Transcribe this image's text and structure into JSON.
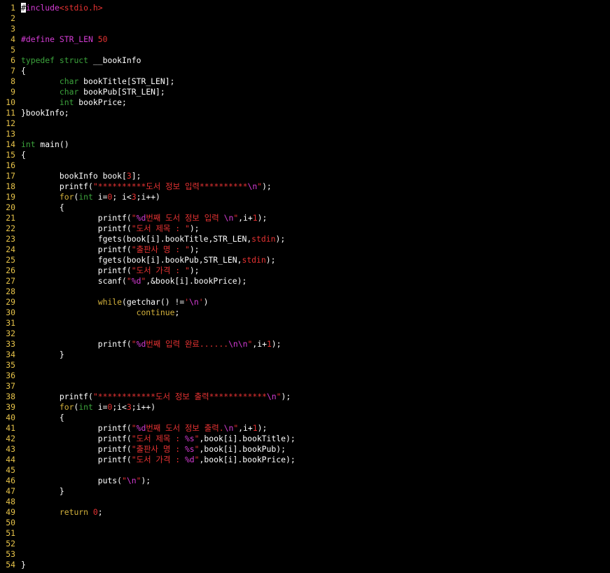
{
  "editor": {
    "colors": {
      "background": "#000000",
      "line_number": "#e8c44a",
      "preprocessor": "#d53cd5",
      "keyword": "#d4b23c",
      "type": "#3ca43c",
      "string": "#e83333",
      "number": "#e83333",
      "escape": "#d53cd5",
      "default": "#ffffff"
    },
    "cursor": {
      "line": 1,
      "column": 1
    },
    "lines": [
      {
        "n": "1",
        "tokens": [
          {
            "t": "#",
            "c": "cursor"
          },
          {
            "t": "include",
            "c": "pre"
          },
          {
            "t": "<stdio.h>",
            "c": "str"
          }
        ]
      },
      {
        "n": "2",
        "tokens": []
      },
      {
        "n": "3",
        "tokens": []
      },
      {
        "n": "4",
        "tokens": [
          {
            "t": "#define STR_LEN ",
            "c": "pre"
          },
          {
            "t": "50",
            "c": "num"
          }
        ]
      },
      {
        "n": "5",
        "tokens": []
      },
      {
        "n": "6",
        "tokens": [
          {
            "t": "typedef",
            "c": "type"
          },
          {
            "t": " ",
            "c": "id"
          },
          {
            "t": "struct",
            "c": "type"
          },
          {
            "t": " __bookInfo",
            "c": "id"
          }
        ]
      },
      {
        "n": "7",
        "tokens": [
          {
            "t": "{",
            "c": "id"
          }
        ]
      },
      {
        "n": "8",
        "tokens": [
          {
            "t": "        ",
            "c": "id"
          },
          {
            "t": "char",
            "c": "type"
          },
          {
            "t": " bookTitle[STR_LEN];",
            "c": "id"
          }
        ]
      },
      {
        "n": "9",
        "tokens": [
          {
            "t": "        ",
            "c": "id"
          },
          {
            "t": "char",
            "c": "type"
          },
          {
            "t": " bookPub[STR_LEN];",
            "c": "id"
          }
        ]
      },
      {
        "n": "10",
        "tokens": [
          {
            "t": "        ",
            "c": "id"
          },
          {
            "t": "int",
            "c": "type"
          },
          {
            "t": " bookPrice;",
            "c": "id"
          }
        ]
      },
      {
        "n": "11",
        "tokens": [
          {
            "t": "}bookInfo;",
            "c": "id"
          }
        ]
      },
      {
        "n": "12",
        "tokens": []
      },
      {
        "n": "13",
        "tokens": []
      },
      {
        "n": "14",
        "tokens": [
          {
            "t": "int",
            "c": "type"
          },
          {
            "t": " main()",
            "c": "id"
          }
        ]
      },
      {
        "n": "15",
        "tokens": [
          {
            "t": "{",
            "c": "id"
          }
        ]
      },
      {
        "n": "16",
        "tokens": []
      },
      {
        "n": "17",
        "tokens": [
          {
            "t": "        bookInfo book[",
            "c": "id"
          },
          {
            "t": "3",
            "c": "num"
          },
          {
            "t": "];",
            "c": "id"
          }
        ]
      },
      {
        "n": "18",
        "tokens": [
          {
            "t": "        printf(",
            "c": "id"
          },
          {
            "t": "\"**********도서 정보 입력**********",
            "c": "str"
          },
          {
            "t": "\\n",
            "c": "esc"
          },
          {
            "t": "\"",
            "c": "str"
          },
          {
            "t": ");",
            "c": "id"
          }
        ]
      },
      {
        "n": "19",
        "tokens": [
          {
            "t": "        ",
            "c": "id"
          },
          {
            "t": "for",
            "c": "kw"
          },
          {
            "t": "(",
            "c": "id"
          },
          {
            "t": "int",
            "c": "type"
          },
          {
            "t": " i=",
            "c": "id"
          },
          {
            "t": "0",
            "c": "num"
          },
          {
            "t": "; i<",
            "c": "id"
          },
          {
            "t": "3",
            "c": "num"
          },
          {
            "t": ";i++)",
            "c": "id"
          }
        ]
      },
      {
        "n": "20",
        "tokens": [
          {
            "t": "        {",
            "c": "id"
          }
        ]
      },
      {
        "n": "21",
        "tokens": [
          {
            "t": "                printf(",
            "c": "id"
          },
          {
            "t": "\"",
            "c": "str"
          },
          {
            "t": "%d",
            "c": "esc"
          },
          {
            "t": "번째 도서 정보 입력 ",
            "c": "str"
          },
          {
            "t": "\\n",
            "c": "esc"
          },
          {
            "t": "\"",
            "c": "str"
          },
          {
            "t": ",i+",
            "c": "id"
          },
          {
            "t": "1",
            "c": "num"
          },
          {
            "t": ");",
            "c": "id"
          }
        ]
      },
      {
        "n": "22",
        "tokens": [
          {
            "t": "                printf(",
            "c": "id"
          },
          {
            "t": "\"도서 제목 : \"",
            "c": "str"
          },
          {
            "t": ");",
            "c": "id"
          }
        ]
      },
      {
        "n": "23",
        "tokens": [
          {
            "t": "                fgets(book[i].bookTitle,STR_LEN,",
            "c": "id"
          },
          {
            "t": "stdin",
            "c": "str"
          },
          {
            "t": ");",
            "c": "id"
          }
        ]
      },
      {
        "n": "24",
        "tokens": [
          {
            "t": "                printf(",
            "c": "id"
          },
          {
            "t": "\"출판사 명 : \"",
            "c": "str"
          },
          {
            "t": ");",
            "c": "id"
          }
        ]
      },
      {
        "n": "25",
        "tokens": [
          {
            "t": "                fgets(book[i].bookPub,STR_LEN,",
            "c": "id"
          },
          {
            "t": "stdin",
            "c": "str"
          },
          {
            "t": ");",
            "c": "id"
          }
        ]
      },
      {
        "n": "26",
        "tokens": [
          {
            "t": "                printf(",
            "c": "id"
          },
          {
            "t": "\"도서 가격 : \"",
            "c": "str"
          },
          {
            "t": ");",
            "c": "id"
          }
        ]
      },
      {
        "n": "27",
        "tokens": [
          {
            "t": "                scanf(",
            "c": "id"
          },
          {
            "t": "\"",
            "c": "str"
          },
          {
            "t": "%d",
            "c": "esc"
          },
          {
            "t": "\"",
            "c": "str"
          },
          {
            "t": ",&book[i].bookPrice);",
            "c": "id"
          }
        ]
      },
      {
        "n": "28",
        "tokens": []
      },
      {
        "n": "29",
        "tokens": [
          {
            "t": "                ",
            "c": "id"
          },
          {
            "t": "while",
            "c": "kw"
          },
          {
            "t": "(getchar() !=",
            "c": "id"
          },
          {
            "t": "'",
            "c": "str"
          },
          {
            "t": "\\n",
            "c": "esc"
          },
          {
            "t": "'",
            "c": "str"
          },
          {
            "t": ")",
            "c": "id"
          }
        ]
      },
      {
        "n": "30",
        "tokens": [
          {
            "t": "                        ",
            "c": "id"
          },
          {
            "t": "continue",
            "c": "kw"
          },
          {
            "t": ";",
            "c": "id"
          }
        ]
      },
      {
        "n": "31",
        "tokens": []
      },
      {
        "n": "32",
        "tokens": []
      },
      {
        "n": "33",
        "tokens": [
          {
            "t": "                printf(",
            "c": "id"
          },
          {
            "t": "\"",
            "c": "str"
          },
          {
            "t": "%d",
            "c": "esc"
          },
          {
            "t": "번째 입력 완료......",
            "c": "str"
          },
          {
            "t": "\\n\\n",
            "c": "esc"
          },
          {
            "t": "\"",
            "c": "str"
          },
          {
            "t": ",i+",
            "c": "id"
          },
          {
            "t": "1",
            "c": "num"
          },
          {
            "t": ");",
            "c": "id"
          }
        ]
      },
      {
        "n": "34",
        "tokens": [
          {
            "t": "        }",
            "c": "id"
          }
        ]
      },
      {
        "n": "35",
        "tokens": []
      },
      {
        "n": "36",
        "tokens": []
      },
      {
        "n": "37",
        "tokens": []
      },
      {
        "n": "38",
        "tokens": [
          {
            "t": "        printf(",
            "c": "id"
          },
          {
            "t": "\"************도서 정보 출력************",
            "c": "str"
          },
          {
            "t": "\\n",
            "c": "esc"
          },
          {
            "t": "\"",
            "c": "str"
          },
          {
            "t": ");",
            "c": "id"
          }
        ]
      },
      {
        "n": "39",
        "tokens": [
          {
            "t": "        ",
            "c": "id"
          },
          {
            "t": "for",
            "c": "kw"
          },
          {
            "t": "(",
            "c": "id"
          },
          {
            "t": "int",
            "c": "type"
          },
          {
            "t": " i=",
            "c": "id"
          },
          {
            "t": "0",
            "c": "num"
          },
          {
            "t": ";i<",
            "c": "id"
          },
          {
            "t": "3",
            "c": "num"
          },
          {
            "t": ";i++)",
            "c": "id"
          }
        ]
      },
      {
        "n": "40",
        "tokens": [
          {
            "t": "        {",
            "c": "id"
          }
        ]
      },
      {
        "n": "41",
        "tokens": [
          {
            "t": "                printf(",
            "c": "id"
          },
          {
            "t": "\"",
            "c": "str"
          },
          {
            "t": "%d",
            "c": "esc"
          },
          {
            "t": "번째 도서 정보 출력.",
            "c": "str"
          },
          {
            "t": "\\n",
            "c": "esc"
          },
          {
            "t": "\"",
            "c": "str"
          },
          {
            "t": ",i+",
            "c": "id"
          },
          {
            "t": "1",
            "c": "num"
          },
          {
            "t": ");",
            "c": "id"
          }
        ]
      },
      {
        "n": "42",
        "tokens": [
          {
            "t": "                printf(",
            "c": "id"
          },
          {
            "t": "\"도서 제목 : ",
            "c": "str"
          },
          {
            "t": "%s",
            "c": "esc"
          },
          {
            "t": "\"",
            "c": "str"
          },
          {
            "t": ",book[i].bookTitle);",
            "c": "id"
          }
        ]
      },
      {
        "n": "43",
        "tokens": [
          {
            "t": "                printf(",
            "c": "id"
          },
          {
            "t": "\"출판사 명 : ",
            "c": "str"
          },
          {
            "t": "%s",
            "c": "esc"
          },
          {
            "t": "\"",
            "c": "str"
          },
          {
            "t": ",book[i].bookPub);",
            "c": "id"
          }
        ]
      },
      {
        "n": "44",
        "tokens": [
          {
            "t": "                printf(",
            "c": "id"
          },
          {
            "t": "\"도서 가격 : ",
            "c": "str"
          },
          {
            "t": "%d",
            "c": "esc"
          },
          {
            "t": "\"",
            "c": "str"
          },
          {
            "t": ",book[i].bookPrice);",
            "c": "id"
          }
        ]
      },
      {
        "n": "45",
        "tokens": []
      },
      {
        "n": "46",
        "tokens": [
          {
            "t": "                puts(",
            "c": "id"
          },
          {
            "t": "\"",
            "c": "str"
          },
          {
            "t": "\\n",
            "c": "esc"
          },
          {
            "t": "\"",
            "c": "str"
          },
          {
            "t": ");",
            "c": "id"
          }
        ]
      },
      {
        "n": "47",
        "tokens": [
          {
            "t": "        }",
            "c": "id"
          }
        ]
      },
      {
        "n": "48",
        "tokens": []
      },
      {
        "n": "49",
        "tokens": [
          {
            "t": "        ",
            "c": "id"
          },
          {
            "t": "return",
            "c": "kw"
          },
          {
            "t": " ",
            "c": "id"
          },
          {
            "t": "0",
            "c": "num"
          },
          {
            "t": ";",
            "c": "id"
          }
        ]
      },
      {
        "n": "50",
        "tokens": []
      },
      {
        "n": "51",
        "tokens": []
      },
      {
        "n": "52",
        "tokens": []
      },
      {
        "n": "53",
        "tokens": []
      },
      {
        "n": "54",
        "tokens": [
          {
            "t": "}",
            "c": "id"
          }
        ]
      }
    ]
  }
}
